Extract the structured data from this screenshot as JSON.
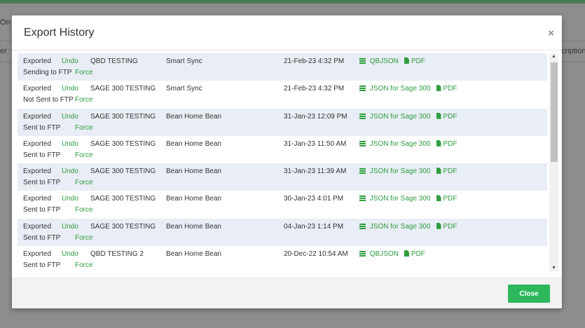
{
  "background": {
    "left_text_1": "On",
    "left_text_2": "er",
    "right_text": "cription"
  },
  "modal": {
    "title": "Export History",
    "close_icon": "×",
    "close_button_label": "Close",
    "rows": [
      {
        "status": "Exported",
        "undo": "Undo",
        "name": "QBD TESTING",
        "client": "Smart Sync",
        "date": "21-Feb-23 4:32 PM",
        "json": "QBJSON",
        "pdf": "PDF",
        "ftp": "Sending to FTP",
        "force": "Force"
      },
      {
        "status": "Exported",
        "undo": "Undo",
        "name": "SAGE 300 TESTING",
        "client": "Smart Sync",
        "date": "21-Feb-23 4:32 PM",
        "json": "JSON for Sage 300",
        "pdf": "PDF",
        "ftp": "Not Sent to FTP",
        "force": "Force"
      },
      {
        "status": "Exported",
        "undo": "Undo",
        "name": "SAGE 300 TESTING",
        "client": "Bean Home Bean",
        "date": "31-Jan-23 12:09 PM",
        "json": "JSON for Sage 300",
        "pdf": "PDF",
        "ftp": "Sent to FTP",
        "force": "Force"
      },
      {
        "status": "Exported",
        "undo": "Undo",
        "name": "SAGE 300 TESTING",
        "client": "Bean Home Bean",
        "date": "31-Jan-23 11:50 AM",
        "json": "JSON for Sage 300",
        "pdf": "PDF",
        "ftp": "Sent to FTP",
        "force": "Force"
      },
      {
        "status": "Exported",
        "undo": "Undo",
        "name": "SAGE 300 TESTING",
        "client": "Bean Home Bean",
        "date": "31-Jan-23 11:39 AM",
        "json": "JSON for Sage 300",
        "pdf": "PDF",
        "ftp": "Sent to FTP",
        "force": "Force"
      },
      {
        "status": "Exported",
        "undo": "Undo",
        "name": "SAGE 300 TESTING",
        "client": "Bean Home Bean",
        "date": "30-Jan-23 4:01 PM",
        "json": "JSON for Sage 300",
        "pdf": "PDF",
        "ftp": "Sent to FTP",
        "force": "Force"
      },
      {
        "status": "Exported",
        "undo": "Undo",
        "name": "SAGE 300 TESTING",
        "client": "Bean Home Bean",
        "date": "04-Jan-23 1:14 PM",
        "json": "JSON for Sage 300",
        "pdf": "PDF",
        "ftp": "Sent to FTP",
        "force": "Force"
      },
      {
        "status": "Exported",
        "undo": "Undo",
        "name": "QBD TESTING 2",
        "client": "Bean Home Bean",
        "date": "20-Dec-22 10:54 AM",
        "json": "QBJSON",
        "pdf": "PDF",
        "ftp": "Sent to FTP",
        "force": "Force"
      }
    ]
  },
  "icons": {
    "json_icon": "list-icon",
    "pdf_icon": "file-icon",
    "scroll_up": "▲",
    "scroll_down": "▼"
  },
  "colors": {
    "accent_green": "#2e9e3e",
    "button_green": "#2eb85c",
    "row_stripe": "#e9edf5"
  }
}
